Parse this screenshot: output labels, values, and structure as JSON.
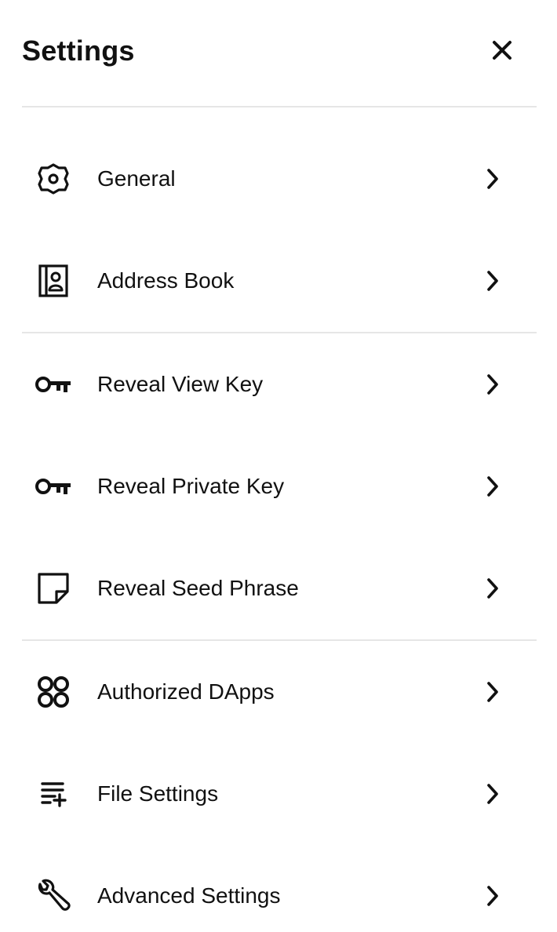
{
  "header": {
    "title": "Settings",
    "close_icon": "close-icon"
  },
  "groups": [
    {
      "items": [
        {
          "label": "General",
          "icon": "gear-icon"
        },
        {
          "label": "Address Book",
          "icon": "address-book-icon"
        }
      ]
    },
    {
      "items": [
        {
          "label": "Reveal View Key",
          "icon": "key-icon"
        },
        {
          "label": "Reveal Private Key",
          "icon": "key-icon"
        },
        {
          "label": "Reveal Seed Phrase",
          "icon": "sticky-note-icon"
        }
      ]
    },
    {
      "items": [
        {
          "label": "Authorized DApps",
          "icon": "four-circles-icon"
        },
        {
          "label": "File Settings",
          "icon": "list-add-icon"
        },
        {
          "label": "Advanced Settings",
          "icon": "wrench-icon"
        }
      ]
    }
  ],
  "colors": {
    "text": "#111111",
    "divider": "#e6e6e6",
    "background": "#ffffff"
  }
}
